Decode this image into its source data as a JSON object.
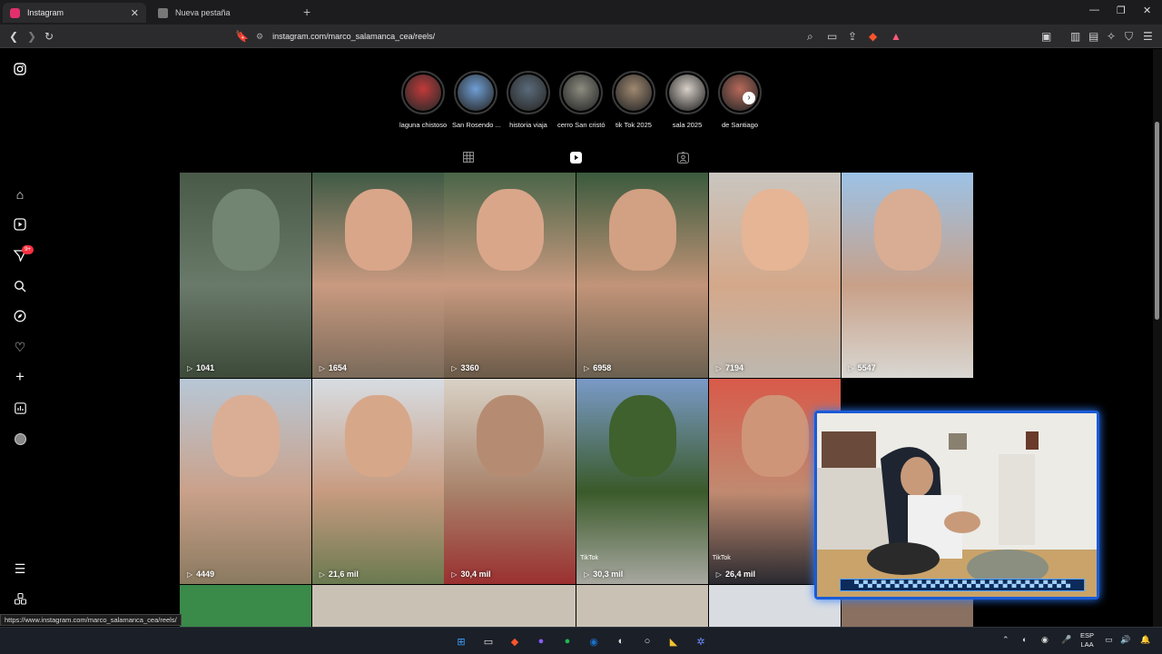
{
  "browser": {
    "tabs": [
      {
        "title": "Instagram",
        "active": true,
        "favicon_color": "#e1306c"
      },
      {
        "title": "Nueva pestaña",
        "active": false,
        "favicon_color": "#9a9a9a"
      }
    ],
    "url": "instagram.com/marco_salamanca_cea/reels/",
    "status_link": "https://www.instagram.com/marco_salamanca_cea/reels/"
  },
  "highlights": [
    {
      "label": "laguna chistoso",
      "color": "#c23a3a"
    },
    {
      "label": "San Rosendo ...",
      "color": "#6f9fd6"
    },
    {
      "label": "historia viaja",
      "color": "#5a6b7a"
    },
    {
      "label": "cerro San cristó",
      "color": "#8c8c80"
    },
    {
      "label": "tik Tok 2025",
      "color": "#a08870"
    },
    {
      "label": "sala 2025",
      "color": "#d8d0c8"
    },
    {
      "label": "de Santiago",
      "color": "#b86a5a"
    }
  ],
  "profile_tabs": [
    {
      "name": "posts",
      "icon": "grid-icon",
      "active": false
    },
    {
      "name": "reels",
      "icon": "reels-icon",
      "active": true
    },
    {
      "name": "tagged",
      "icon": "tagged-icon",
      "active": false
    }
  ],
  "reels": [
    {
      "views": "1041",
      "colors": [
        "#4a5a48",
        "#6a7a6a",
        "#3d4a3a"
      ],
      "tiktok": false
    },
    {
      "views": "1654",
      "colors": [
        "#3f5a45",
        "#c99a80",
        "#7a6a5a"
      ],
      "tiktok": false
    },
    {
      "views": "3360",
      "colors": [
        "#4a6548",
        "#c99a80",
        "#6a5a48"
      ],
      "tiktok": false
    },
    {
      "views": "6958",
      "colors": [
        "#3a5a3d",
        "#c29478",
        "#6a6050"
      ],
      "tiktok": false
    },
    {
      "views": "7194",
      "colors": [
        "#c9c6c0",
        "#d4a88a",
        "#bdb8b0"
      ],
      "tiktok": false
    },
    {
      "views": "5547",
      "colors": [
        "#9cc2e6",
        "#c8a088",
        "#d9d7d2"
      ],
      "tiktok": false
    },
    {
      "views": "4449",
      "colors": [
        "#b7c7d6",
        "#caa18a",
        "#8a7a60"
      ],
      "tiktok": false
    },
    {
      "views": "21,6 mil",
      "colors": [
        "#d7dde3",
        "#c79b80",
        "#6a7a50"
      ],
      "tiktok": false
    },
    {
      "views": "30,4 mil",
      "colors": [
        "#d9d2c6",
        "#a8826a",
        "#9a3030"
      ],
      "tiktok": false
    },
    {
      "views": "30,3 mil",
      "colors": [
        "#7a9ac8",
        "#3a5a2a",
        "#a8a8a0"
      ],
      "tiktok": true
    },
    {
      "views": "26,4 mil",
      "colors": [
        "#d85a4a",
        "#c08a70",
        "#2a2a30"
      ],
      "tiktok": true
    }
  ],
  "tiktok_text": "TikTok",
  "webcam_bar_text": "▀▄▀▄▀▄▀▄▀▄▀▄▀▄▀▄▀▄▀▄▀▄▀▄▀▄▀▄▀▄▀▄▀▄▀▄▀▄▀▄▀▄▀▄▀▄▀▄",
  "taskbar": {
    "apps": [
      {
        "name": "start",
        "color": "#3aa0ff"
      },
      {
        "name": "file-explorer",
        "color": "#e6e6e6"
      },
      {
        "name": "brave",
        "color": "#fb542b"
      },
      {
        "name": "app-purple",
        "color": "#8a5cf6"
      },
      {
        "name": "spotify",
        "color": "#1db954"
      },
      {
        "name": "steam",
        "color": "#1b6fc5"
      },
      {
        "name": "app-g",
        "color": "#e0e0e0"
      },
      {
        "name": "app-opera",
        "color": "#e0e0e0"
      },
      {
        "name": "app-yellow",
        "color": "#f2c230"
      },
      {
        "name": "app-settings",
        "color": "#6a8cff"
      }
    ],
    "lang_top": "ESP",
    "lang_bottom": "LAA"
  }
}
